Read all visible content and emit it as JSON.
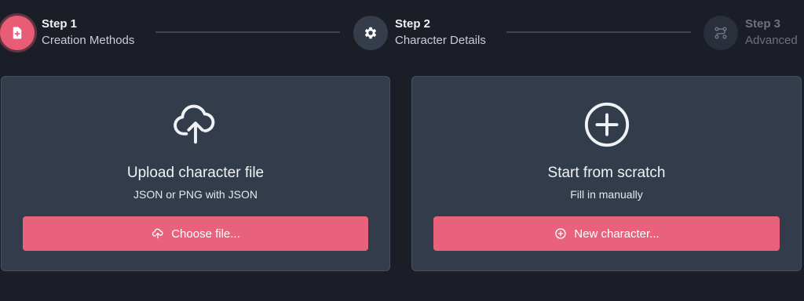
{
  "stepper": {
    "steps": [
      {
        "title": "Step 1",
        "subtitle": "Creation Methods",
        "icon": "file-plus-icon",
        "state": "active",
        "color": "#e85d75"
      },
      {
        "title": "Step 2",
        "subtitle": "Character Details",
        "icon": "gear-icon",
        "state": "upcoming"
      },
      {
        "title": "Step 3",
        "subtitle": "Advanced",
        "icon": "flow-icon",
        "state": "disabled"
      }
    ]
  },
  "cards": {
    "upload": {
      "icon": "cloud-upload-icon",
      "title": "Upload character file",
      "subtitle": "JSON or PNG with JSON",
      "button_label": "Choose file...",
      "button_icon": "cloud-upload-icon"
    },
    "scratch": {
      "icon": "plus-circle-icon",
      "title": "Start from scratch",
      "subtitle": "Fill in manually",
      "button_label": "New character...",
      "button_icon": "plus-circle-icon"
    }
  },
  "colors": {
    "background": "#1b1e26",
    "card": "#323c4b",
    "accent": "#e8627c"
  }
}
